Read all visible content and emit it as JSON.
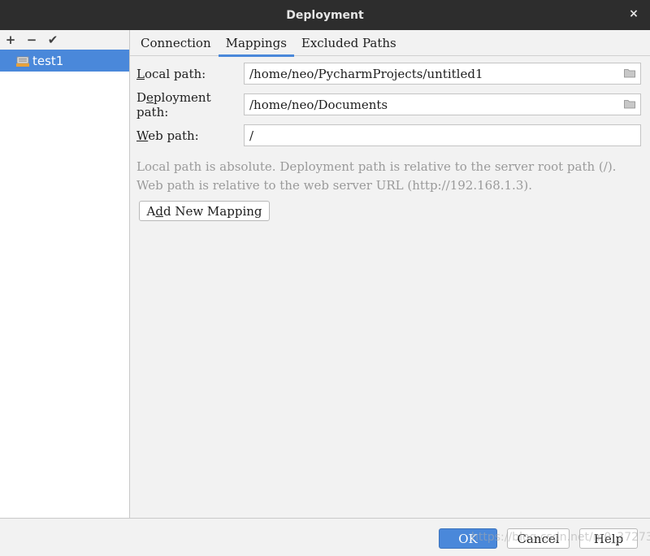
{
  "window": {
    "title": "Deployment",
    "close_glyph": "×"
  },
  "sidebar": {
    "toolbar": {
      "add": "+",
      "remove": "−",
      "apply": "✔"
    },
    "servers": [
      {
        "name": "test1",
        "icon": "sftp-server-icon"
      }
    ]
  },
  "tabs": [
    {
      "label": "Connection",
      "active": false
    },
    {
      "label": "Mappings",
      "active": true
    },
    {
      "label": "Excluded Paths",
      "active": false
    }
  ],
  "mappings": {
    "local_path": {
      "label_mnemonic": "L",
      "label_rest": "ocal path:",
      "value": "/home/neo/PycharmProjects/untitled1"
    },
    "deployment_path": {
      "label_pre": "D",
      "label_mnemonic": "e",
      "label_rest": "ployment path:",
      "value": "/home/neo/Documents"
    },
    "web_path": {
      "label_mnemonic": "W",
      "label_rest": "eb path:",
      "value": "/"
    },
    "hint_line1": "Local path is absolute. Deployment path is relative to the server root path (/).",
    "hint_line2": "Web path is relative to the web server URL (http://192.168.1.3).",
    "add_button": {
      "pre": "A",
      "mnemonic": "d",
      "rest": "d New Mapping"
    }
  },
  "buttons": {
    "ok": "OK",
    "cancel": "Cancel",
    "help": "Help"
  },
  "watermark": "https://blog.csdn.net/m0_37273",
  "colors": {
    "accent": "#4a88da",
    "titlebar": "#2d2d2d"
  }
}
